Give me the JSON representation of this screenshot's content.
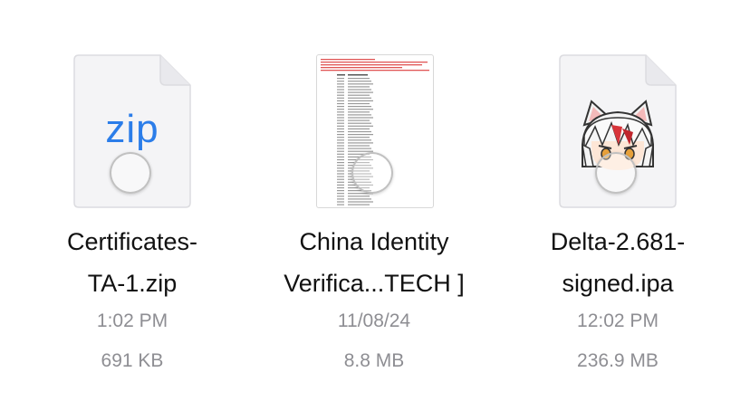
{
  "files": [
    {
      "kind": "zip",
      "icon": "zip-document-icon",
      "icon_text": "zip",
      "name_line1": "Certificates-",
      "name_line2": "TA-1.zip",
      "date": "1:02 PM",
      "size": "691 KB"
    },
    {
      "kind": "document-preview",
      "icon": "document-preview-thumbnail",
      "name_line1": "China Identity",
      "name_line2": "Verifica...TECH ]",
      "date": "11/08/24",
      "size": "8.8 MB"
    },
    {
      "kind": "ipa",
      "icon": "app-icon-thumbnail",
      "name_line1": "Delta-2.681-",
      "name_line2": "signed.ipa",
      "date": "12:02 PM",
      "size": "236.9 MB"
    }
  ],
  "colors": {
    "zip_text": "#2b7de9",
    "meta_text": "#8e8e93",
    "name_text": "#111111"
  }
}
